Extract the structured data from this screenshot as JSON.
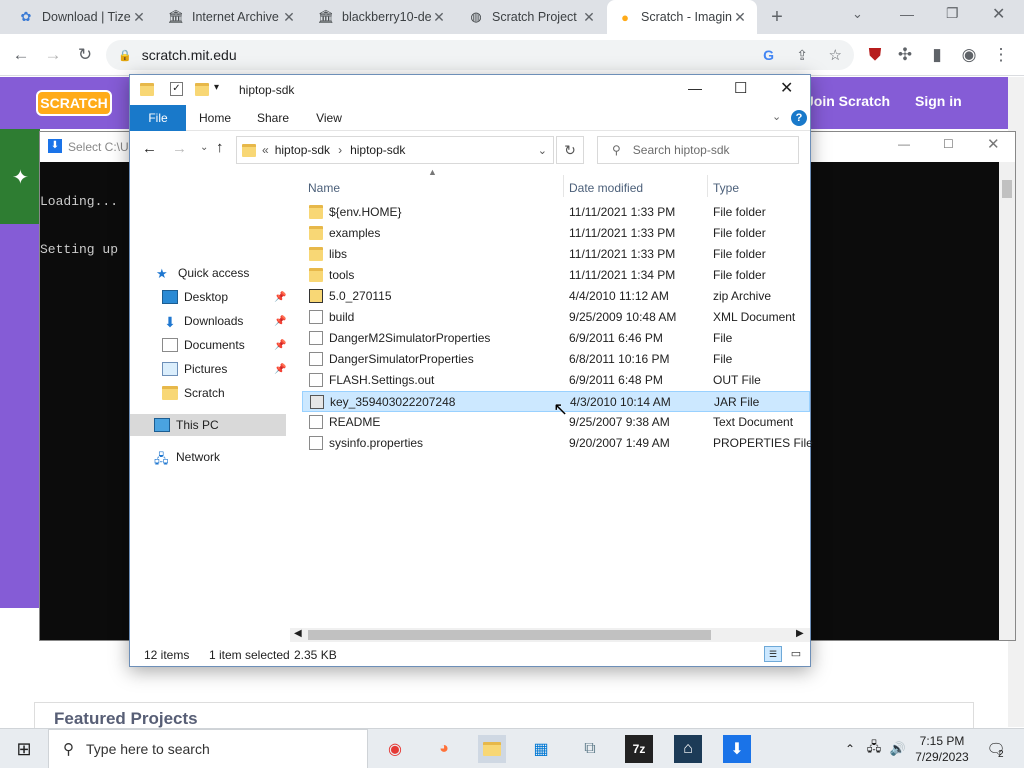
{
  "browser": {
    "tabs": [
      {
        "label": "Download | Tize",
        "icon": "tizen-icon",
        "active": false
      },
      {
        "label": "Internet Archive",
        "icon": "archive-icon",
        "active": false
      },
      {
        "label": "blackberry10-de",
        "icon": "archive-icon",
        "active": false
      },
      {
        "label": "Scratch Project",
        "icon": "globe-icon",
        "active": false
      },
      {
        "label": "Scratch - Imagin",
        "icon": "scratch-icon",
        "active": true
      }
    ],
    "url": "scratch.mit.edu",
    "new_tab": "+"
  },
  "scratch": {
    "logo": "SCRATCH",
    "join": "Join Scratch",
    "signin": "Sign in",
    "featured": "Featured Projects"
  },
  "console": {
    "title": "Select C:\\Us",
    "line1": "Loading...",
    "line2": "Setting up"
  },
  "explorer": {
    "title": "hiptop-sdk",
    "ribbon": {
      "file": "File",
      "home": "Home",
      "share": "Share",
      "view": "View"
    },
    "address": {
      "overflow": "«",
      "crumb1": "hiptop-sdk",
      "crumb2": "hiptop-sdk"
    },
    "search_placeholder": "Search hiptop-sdk",
    "nav": {
      "quick_access": "Quick access",
      "desktop": "Desktop",
      "downloads": "Downloads",
      "documents": "Documents",
      "pictures": "Pictures",
      "scratch": "Scratch",
      "this_pc": "This PC",
      "network": "Network"
    },
    "columns": {
      "name": "Name",
      "date": "Date modified",
      "type": "Type"
    },
    "files": [
      {
        "name": "${env.HOME}",
        "date": "11/11/2021 1:33 PM",
        "type": "File folder",
        "icon": "folder"
      },
      {
        "name": "examples",
        "date": "11/11/2021 1:33 PM",
        "type": "File folder",
        "icon": "folder"
      },
      {
        "name": "libs",
        "date": "11/11/2021 1:33 PM",
        "type": "File folder",
        "icon": "folder"
      },
      {
        "name": "tools",
        "date": "11/11/2021 1:34 PM",
        "type": "File folder",
        "icon": "folder"
      },
      {
        "name": "5.0_270115",
        "date": "4/4/2010 11:12 AM",
        "type": "zip Archive",
        "icon": "zip"
      },
      {
        "name": "build",
        "date": "9/25/2009 10:48 AM",
        "type": "XML Document",
        "icon": "doc"
      },
      {
        "name": "DangerM2SimulatorProperties",
        "date": "6/9/2011 6:46 PM",
        "type": "File",
        "icon": "doc"
      },
      {
        "name": "DangerSimulatorProperties",
        "date": "6/8/2011 10:16 PM",
        "type": "File",
        "icon": "doc"
      },
      {
        "name": "FLASH.Settings.out",
        "date": "6/9/2011 6:48 PM",
        "type": "OUT File",
        "icon": "doc"
      },
      {
        "name": "key_359403022207248",
        "date": "4/3/2010 10:14 AM",
        "type": "JAR File",
        "icon": "jar",
        "selected": true
      },
      {
        "name": "README",
        "date": "9/25/2007 9:38 AM",
        "type": "Text Document",
        "icon": "doc"
      },
      {
        "name": "sysinfo.properties",
        "date": "9/20/2007 1:49 AM",
        "type": "PROPERTIES File",
        "icon": "doc"
      }
    ],
    "status": {
      "items": "12 items",
      "selected": "1 item selected",
      "size": "2.35 KB"
    }
  },
  "taskbar": {
    "search_placeholder": "Type here to search",
    "time": "7:15 PM",
    "date": "7/29/2023",
    "notifications": "2",
    "app_7z": "7z"
  }
}
